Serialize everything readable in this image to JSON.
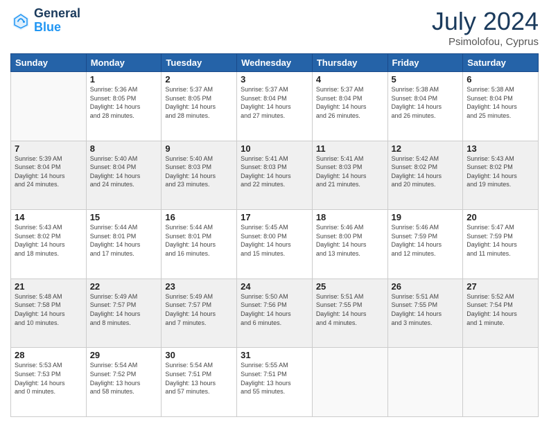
{
  "logo": {
    "line1": "General",
    "line2": "Blue"
  },
  "title": "July 2024",
  "subtitle": "Psimolofou, Cyprus",
  "days_header": [
    "Sunday",
    "Monday",
    "Tuesday",
    "Wednesday",
    "Thursday",
    "Friday",
    "Saturday"
  ],
  "weeks": [
    [
      {
        "num": "",
        "info": ""
      },
      {
        "num": "1",
        "info": "Sunrise: 5:36 AM\nSunset: 8:05 PM\nDaylight: 14 hours\nand 28 minutes."
      },
      {
        "num": "2",
        "info": "Sunrise: 5:37 AM\nSunset: 8:05 PM\nDaylight: 14 hours\nand 28 minutes."
      },
      {
        "num": "3",
        "info": "Sunrise: 5:37 AM\nSunset: 8:04 PM\nDaylight: 14 hours\nand 27 minutes."
      },
      {
        "num": "4",
        "info": "Sunrise: 5:37 AM\nSunset: 8:04 PM\nDaylight: 14 hours\nand 26 minutes."
      },
      {
        "num": "5",
        "info": "Sunrise: 5:38 AM\nSunset: 8:04 PM\nDaylight: 14 hours\nand 26 minutes."
      },
      {
        "num": "6",
        "info": "Sunrise: 5:38 AM\nSunset: 8:04 PM\nDaylight: 14 hours\nand 25 minutes."
      }
    ],
    [
      {
        "num": "7",
        "info": "Sunrise: 5:39 AM\nSunset: 8:04 PM\nDaylight: 14 hours\nand 24 minutes."
      },
      {
        "num": "8",
        "info": "Sunrise: 5:40 AM\nSunset: 8:04 PM\nDaylight: 14 hours\nand 24 minutes."
      },
      {
        "num": "9",
        "info": "Sunrise: 5:40 AM\nSunset: 8:03 PM\nDaylight: 14 hours\nand 23 minutes."
      },
      {
        "num": "10",
        "info": "Sunrise: 5:41 AM\nSunset: 8:03 PM\nDaylight: 14 hours\nand 22 minutes."
      },
      {
        "num": "11",
        "info": "Sunrise: 5:41 AM\nSunset: 8:03 PM\nDaylight: 14 hours\nand 21 minutes."
      },
      {
        "num": "12",
        "info": "Sunrise: 5:42 AM\nSunset: 8:02 PM\nDaylight: 14 hours\nand 20 minutes."
      },
      {
        "num": "13",
        "info": "Sunrise: 5:43 AM\nSunset: 8:02 PM\nDaylight: 14 hours\nand 19 minutes."
      }
    ],
    [
      {
        "num": "14",
        "info": "Sunrise: 5:43 AM\nSunset: 8:02 PM\nDaylight: 14 hours\nand 18 minutes."
      },
      {
        "num": "15",
        "info": "Sunrise: 5:44 AM\nSunset: 8:01 PM\nDaylight: 14 hours\nand 17 minutes."
      },
      {
        "num": "16",
        "info": "Sunrise: 5:44 AM\nSunset: 8:01 PM\nDaylight: 14 hours\nand 16 minutes."
      },
      {
        "num": "17",
        "info": "Sunrise: 5:45 AM\nSunset: 8:00 PM\nDaylight: 14 hours\nand 15 minutes."
      },
      {
        "num": "18",
        "info": "Sunrise: 5:46 AM\nSunset: 8:00 PM\nDaylight: 14 hours\nand 13 minutes."
      },
      {
        "num": "19",
        "info": "Sunrise: 5:46 AM\nSunset: 7:59 PM\nDaylight: 14 hours\nand 12 minutes."
      },
      {
        "num": "20",
        "info": "Sunrise: 5:47 AM\nSunset: 7:59 PM\nDaylight: 14 hours\nand 11 minutes."
      }
    ],
    [
      {
        "num": "21",
        "info": "Sunrise: 5:48 AM\nSunset: 7:58 PM\nDaylight: 14 hours\nand 10 minutes."
      },
      {
        "num": "22",
        "info": "Sunrise: 5:49 AM\nSunset: 7:57 PM\nDaylight: 14 hours\nand 8 minutes."
      },
      {
        "num": "23",
        "info": "Sunrise: 5:49 AM\nSunset: 7:57 PM\nDaylight: 14 hours\nand 7 minutes."
      },
      {
        "num": "24",
        "info": "Sunrise: 5:50 AM\nSunset: 7:56 PM\nDaylight: 14 hours\nand 6 minutes."
      },
      {
        "num": "25",
        "info": "Sunrise: 5:51 AM\nSunset: 7:55 PM\nDaylight: 14 hours\nand 4 minutes."
      },
      {
        "num": "26",
        "info": "Sunrise: 5:51 AM\nSunset: 7:55 PM\nDaylight: 14 hours\nand 3 minutes."
      },
      {
        "num": "27",
        "info": "Sunrise: 5:52 AM\nSunset: 7:54 PM\nDaylight: 14 hours\nand 1 minute."
      }
    ],
    [
      {
        "num": "28",
        "info": "Sunrise: 5:53 AM\nSunset: 7:53 PM\nDaylight: 14 hours\nand 0 minutes."
      },
      {
        "num": "29",
        "info": "Sunrise: 5:54 AM\nSunset: 7:52 PM\nDaylight: 13 hours\nand 58 minutes."
      },
      {
        "num": "30",
        "info": "Sunrise: 5:54 AM\nSunset: 7:51 PM\nDaylight: 13 hours\nand 57 minutes."
      },
      {
        "num": "31",
        "info": "Sunrise: 5:55 AM\nSunset: 7:51 PM\nDaylight: 13 hours\nand 55 minutes."
      },
      {
        "num": "",
        "info": ""
      },
      {
        "num": "",
        "info": ""
      },
      {
        "num": "",
        "info": ""
      }
    ]
  ]
}
